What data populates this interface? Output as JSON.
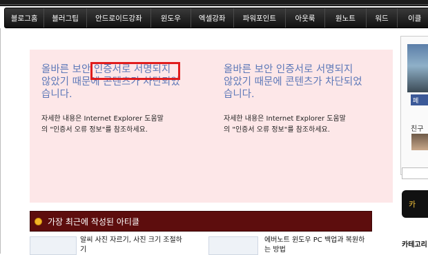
{
  "nav": {
    "items": [
      "블로그홈",
      "블러그팁",
      "안드로이드강좌",
      "윈도우",
      "엑셀강좌",
      "파워포인트",
      "아웃룩",
      "원노트",
      "워드",
      "이클"
    ]
  },
  "cert_error": {
    "col1": {
      "heading": [
        "올바른 보안 인증서로 서명되지",
        "않았기 때문에 콘텐츠가 차단되었",
        "습니다."
      ],
      "body": [
        "자세한 내용은 Internet Explorer 도움말",
        "의 \"인증서 오류 정보\"를 참조하세요."
      ]
    },
    "col2": {
      "heading": [
        "올바른 보안 인증서로 서명되지",
        "않았기 때문에 콘텐츠가 차단되었",
        "습니다."
      ],
      "body": [
        "자세한 내용은 Internet Explorer 도움말",
        "의 \"인증서 오류 정보\"를 참조하세요."
      ]
    }
  },
  "recent": {
    "title": "가장 최근에 작성된 아티클"
  },
  "articles": [
    {
      "title": [
        "알씨 사진 자르기, 사진 크기 조절하",
        "기"
      ]
    },
    {
      "title": [
        "에버노트 윈도우 PC 백업과 복원하",
        "는 방법"
      ]
    }
  ],
  "sidebar": {
    "fb_label": "페",
    "friends_label": "친구",
    "black_label": "카",
    "category_label": "카테고리"
  },
  "colors": {
    "cert_bg": "#fde7e8",
    "cert_heading": "#5d78b8",
    "highlight": "#e01c1c",
    "recent_bg": "#5d0d0d"
  }
}
